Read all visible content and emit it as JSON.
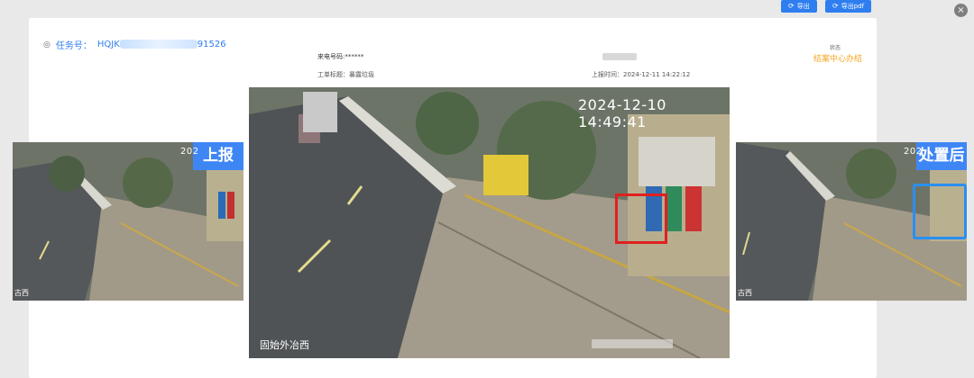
{
  "toolbar": {
    "export_label": "导出",
    "export_pdf_label": "导出pdf",
    "refresh_icon": "refresh-icon"
  },
  "task": {
    "prefix": "任务号：",
    "id_visible_start": "HQJK",
    "id_visible_end": "91526"
  },
  "meta": {
    "caller_label": "来电号码:******",
    "title_label": "工单标题：暴露垃圾",
    "report_time": "上报时间：2024-12-11 14:22:12"
  },
  "status": {
    "label": "状态",
    "value": "结案中心办结"
  },
  "photos": {
    "left": {
      "tag": "上报",
      "timestamp_partial": "202",
      "camera_partial": "古西"
    },
    "center": {
      "timestamp": "2024-12-10 14:49:41",
      "camera": "固始外冶西"
    },
    "right": {
      "tag": "处置后",
      "timestamp_partial": "202",
      "camera_partial": "古西"
    }
  },
  "colors": {
    "accent": "#2f7ef0",
    "status": "#f5a623",
    "tag_bg": "#3f86f5",
    "highlight_red": "#e02020",
    "highlight_blue": "#2a8ff0"
  }
}
